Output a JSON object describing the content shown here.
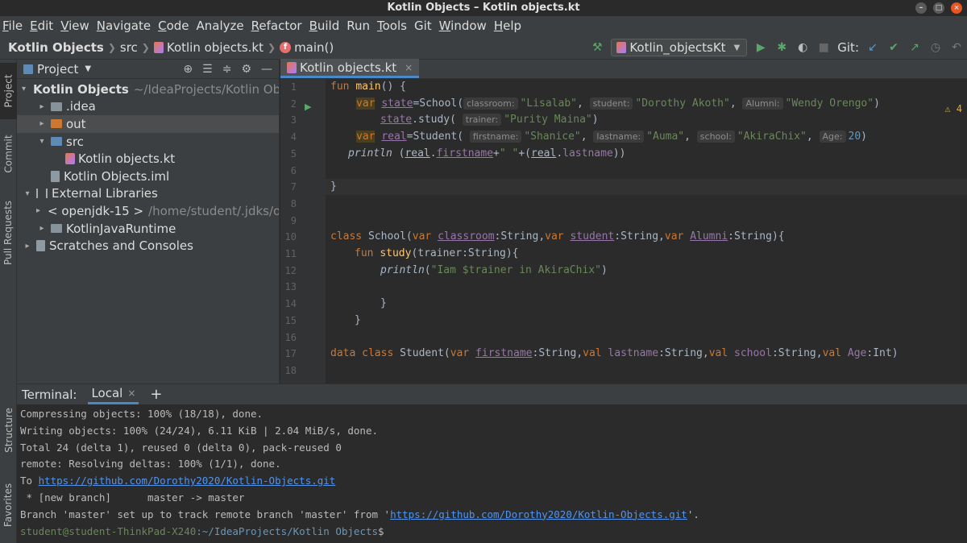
{
  "window": {
    "title": "Kotlin Objects – Kotlin objects.kt"
  },
  "menu": {
    "items": [
      {
        "label": "File",
        "u": "F",
        "rest": "ile"
      },
      {
        "label": "Edit",
        "u": "E",
        "rest": "dit"
      },
      {
        "label": "View",
        "u": "V",
        "rest": "iew"
      },
      {
        "label": "Navigate",
        "u": "N",
        "rest": "avigate"
      },
      {
        "label": "Code",
        "u": "C",
        "rest": "ode"
      },
      {
        "label": "Analyze",
        "u": "",
        "rest": "Analyze"
      },
      {
        "label": "Refactor",
        "u": "R",
        "rest": "efactor"
      },
      {
        "label": "Build",
        "u": "B",
        "rest": "uild"
      },
      {
        "label": "Run",
        "u": "",
        "rest": "Run"
      },
      {
        "label": "Tools",
        "u": "T",
        "rest": "ools"
      },
      {
        "label": "Git",
        "u": "",
        "rest": "Git"
      },
      {
        "label": "Window",
        "u": "W",
        "rest": "indow"
      },
      {
        "label": "Help",
        "u": "H",
        "rest": "elp"
      }
    ]
  },
  "breadcrumbs": {
    "project": "Kotlin Objects",
    "folder": "src",
    "file": "Kotlin objects.kt",
    "fn": "main()",
    "fn_badge": "f"
  },
  "toolbar": {
    "run_config": "Kotlin_objectsKt",
    "git_label": "Git:"
  },
  "sidebar_tabs": {
    "project": "Project",
    "commit": "Commit",
    "pull_requests": "Pull Requests",
    "structure": "Structure",
    "favorites": "Favorites"
  },
  "project_panel": {
    "header": "Project",
    "tree": [
      {
        "label": "Kotlin Objects",
        "muted": "~/IdeaProjects/Kotlin Obje",
        "chev": "▾",
        "indent": 0,
        "icon": "folder-blue",
        "bold": true
      },
      {
        "label": ".idea",
        "muted": "",
        "chev": "▸",
        "indent": 1,
        "icon": "folder"
      },
      {
        "label": "out",
        "muted": "",
        "chev": "▸",
        "indent": 1,
        "icon": "folder-orange",
        "selected": true
      },
      {
        "label": "src",
        "muted": "",
        "chev": "▾",
        "indent": 1,
        "icon": "folder-blue"
      },
      {
        "label": "Kotlin objects.kt",
        "muted": "",
        "chev": "",
        "indent": 2,
        "icon": "kt"
      },
      {
        "label": "Kotlin Objects.iml",
        "muted": "",
        "chev": "",
        "indent": 1,
        "icon": "file"
      },
      {
        "label": "External Libraries",
        "muted": "",
        "chev": "▾",
        "indent": 0,
        "icon": "lib"
      },
      {
        "label": "< openjdk-15 >",
        "muted": "/home/student/.jdks/op",
        "chev": "▸",
        "indent": 1,
        "icon": "folder"
      },
      {
        "label": "KotlinJavaRuntime",
        "muted": "",
        "chev": "▸",
        "indent": 1,
        "icon": "folder"
      },
      {
        "label": "Scratches and Consoles",
        "muted": "",
        "chev": "▸",
        "indent": 0,
        "icon": "file"
      }
    ]
  },
  "editor": {
    "tab_label": "Kotlin objects.kt",
    "warning_count": "4",
    "line_numbers": [
      "1",
      "2",
      "3",
      "4",
      "5",
      "6",
      "7",
      "8",
      "9",
      "10",
      "11",
      "12",
      "13",
      "14",
      "15",
      "16",
      "17",
      "18"
    ]
  },
  "code": {
    "l1_kw": "fun",
    "l1_fn": "main",
    "l1_rest": "() {",
    "l2_var": "var",
    "l2_name": "state",
    "l2_ctor": "=School(",
    "l2_h1": "classroom:",
    "l2_s1": "\"Lisalab\"",
    "l2_h2": "student:",
    "l2_s2": "\"Dorothy Akoth\"",
    "l2_h3": "Alumni:",
    "l2_s3": "\"Wendy Orengo\"",
    "l2_end": ")",
    "l3_name": "state",
    "l3_call": ".study(",
    "l3_h1": "trainer:",
    "l3_s1": "\"Purity Maina\"",
    "l3_end": ")",
    "l4_var": "var",
    "l4_name": "real",
    "l4_ctor": "=Student(",
    "l4_h1": "firstname:",
    "l4_s1": "\"Shanice\"",
    "l4_h2": "lastname:",
    "l4_s2": "\"Auma\"",
    "l4_h3": "school:",
    "l4_s3": "\"AkiraChix\"",
    "l4_h4": "Age:",
    "l4_n4": "20",
    "l4_end": ")",
    "l5_fn": "println",
    "l5_a": " (",
    "l5_real1": "real",
    "l5_dot1": ".",
    "l5_first": "firstname",
    "l5_plus": "+",
    "l5_sp": "\" \"",
    "l5_plus2": "+(",
    "l5_real2": "real",
    "l5_dot2": ".",
    "l5_last": "lastname",
    "l5_end": "))",
    "l7": "}",
    "l10_kw": "class",
    "l10_name": " School(",
    "l10_v1": "var",
    "l10_p1": "classroom",
    "l10_t1": ":String,",
    "l10_v2": "var",
    "l10_p2": "student",
    "l10_t2": ":String,",
    "l10_v3": "var",
    "l10_p3": "Alumni",
    "l10_t3": ":String){",
    "l11_kw": "fun",
    "l11_fn": "study",
    "l11_rest": "(trainer:String){",
    "l12_fn": "println",
    "l12_a": "(",
    "l12_s": "\"Iam $trainer in AkiraChix\"",
    "l12_end": ")",
    "l14": "}",
    "l15": "}",
    "l17_kw": "data class",
    "l17_name": " Student(",
    "l17_v1": "var",
    "l17_p1": "firstname",
    "l17_t1": ":String,",
    "l17_v2": "val",
    "l17_p2": " lastname",
    "l17_t2": ":String,",
    "l17_v3": "val",
    "l17_p3": " school",
    "l17_t3": ":String,",
    "l17_v4": "val",
    "l17_p4": " Age",
    "l17_t4": ":Int)"
  },
  "terminal": {
    "title": "Terminal:",
    "tab": "Local",
    "lines": {
      "l1": "Compressing objects: 100% (18/18), done.",
      "l2": "Writing objects: 100% (24/24), 6.11 KiB | 2.04 MiB/s, done.",
      "l3": "Total 24 (delta 1), reused 0 (delta 0), pack-reused 0",
      "l4": "remote: Resolving deltas: 100% (1/1), done.",
      "l5_pre": "To ",
      "l5_link": "https://github.com/Dorothy2020/Kotlin-Objects.git",
      "l6": " * [new branch]      master -> master",
      "l7_pre": "Branch 'master' set up to track remote branch 'master' from '",
      "l7_link": "https://github.com/Dorothy2020/Kotlin-Objects.git",
      "l7_post": "'.",
      "prompt_user": "student@student-ThinkPad-X240",
      "prompt_path": ":~/IdeaProjects/Kotlin Objects",
      "prompt_end": "$"
    }
  }
}
